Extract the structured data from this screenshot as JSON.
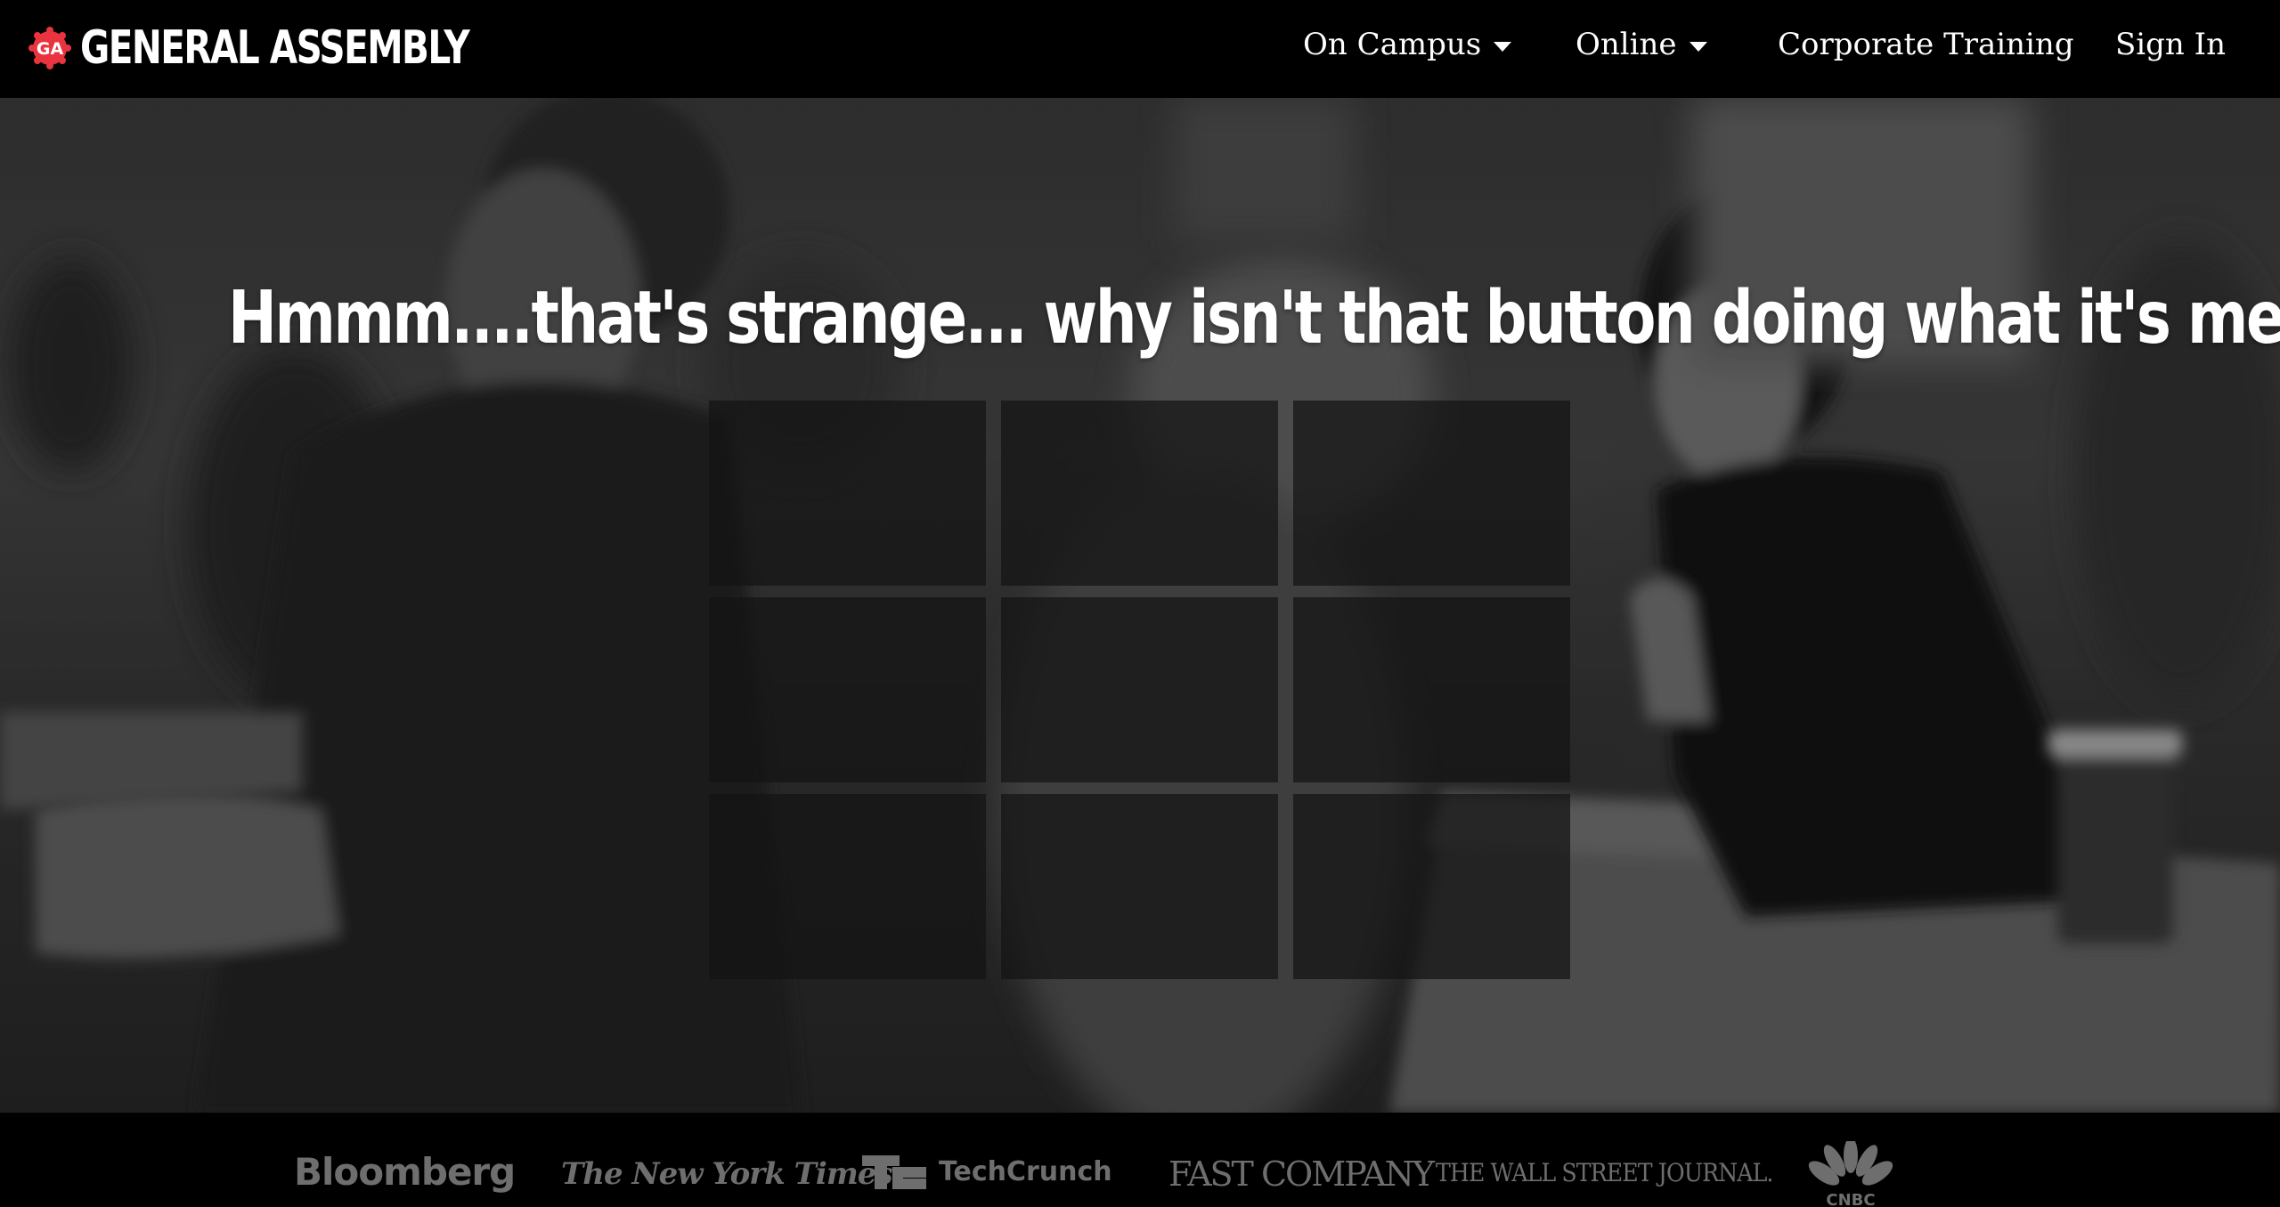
{
  "header": {
    "brand_badge_text": "GA",
    "brand_name": "GENERAL ASSEMBLY",
    "nav": {
      "on_campus": "On Campus",
      "online": "Online",
      "corporate": "Corporate Training",
      "sign_in": "Sign In"
    }
  },
  "hero": {
    "headline": "Hmmm....that's strange... why isn't that button doing what it's meant to do?",
    "tile_count": 9
  },
  "press": {
    "bloomberg": "Bloomberg",
    "nyt": "The New York Times",
    "techcrunch": "TechCrunch",
    "fastcompany": "FAST COMPANY",
    "wsj": "THE WALL STREET JOURNAL.",
    "cnbc": "CNBC"
  },
  "colors": {
    "brand_red": "#e93440",
    "header_bg": "#000000",
    "press_logo": "#6e6e6e",
    "tile_fill": "#141414"
  }
}
